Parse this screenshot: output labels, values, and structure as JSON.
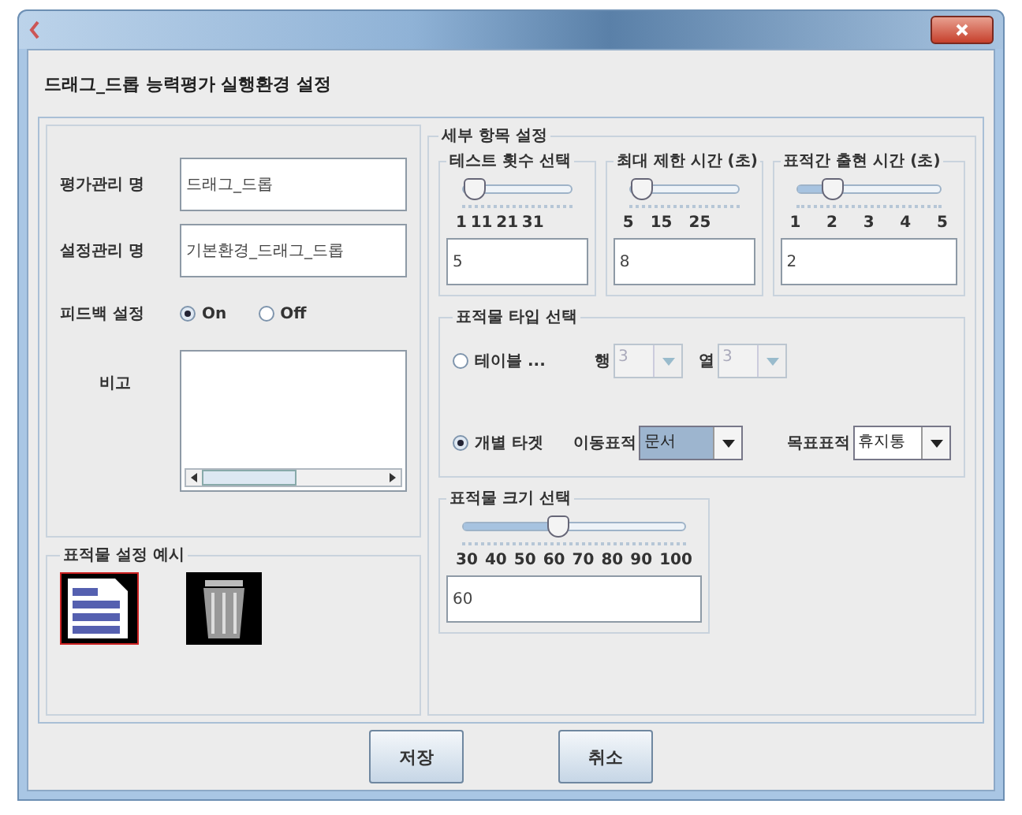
{
  "header": "드래그_드롭 능력평가 실행환경 설정",
  "form": {
    "fields": [
      {
        "label": "평가관리 명",
        "value": "드래그_드롭"
      },
      {
        "label": "설정관리 명",
        "value": "기본환경_드래그_드롭"
      }
    ],
    "feedback": {
      "label": "피드백 설정",
      "options": [
        {
          "label": "On",
          "selected": true
        },
        {
          "label": "Off",
          "selected": false
        }
      ]
    },
    "note": {
      "label": "비고"
    }
  },
  "example": {
    "title": "표적물 설정 예시"
  },
  "detail": {
    "title": "세부 항목 설정",
    "sliders": [
      {
        "title": "테스트 횟수 선택",
        "ticks": [
          "1",
          "11",
          "21",
          "31"
        ],
        "level": 0.1,
        "value": "5"
      },
      {
        "title": "최대 제한 시간 (초)",
        "ticks": [
          "5",
          "15",
          "25"
        ],
        "level": 0.1,
        "value": "8"
      },
      {
        "title": "표적간 출현 시간 (초)",
        "ticks": [
          "1",
          "2",
          "3",
          "4",
          "5"
        ],
        "level": 0.25,
        "value": "2"
      }
    ],
    "target_type": {
      "title": "표적물 타입 선택",
      "options": [
        {
          "kind": "table",
          "label": "테이블 ...",
          "selected": false,
          "combos": [
            {
              "label": "행",
              "value": "3",
              "disabled": true,
              "highlighted": false
            },
            {
              "label": "열",
              "value": "3",
              "disabled": true,
              "highlighted": false
            }
          ]
        },
        {
          "kind": "individual",
          "label": "개별 타겟",
          "selected": true,
          "combos": [
            {
              "label": "이동표적",
              "value": "문서",
              "disabled": false,
              "highlighted": true
            },
            {
              "label": "목표표적",
              "value": "휴지통",
              "disabled": false,
              "highlighted": false
            }
          ]
        }
      ]
    },
    "size": {
      "title": "표적물 크기 선택",
      "ticks": [
        "30",
        "40",
        "50",
        "60",
        "70",
        "80",
        "90",
        "100"
      ],
      "level": 0.43,
      "value": "60"
    }
  },
  "buttons": [
    "저장",
    "취소"
  ]
}
